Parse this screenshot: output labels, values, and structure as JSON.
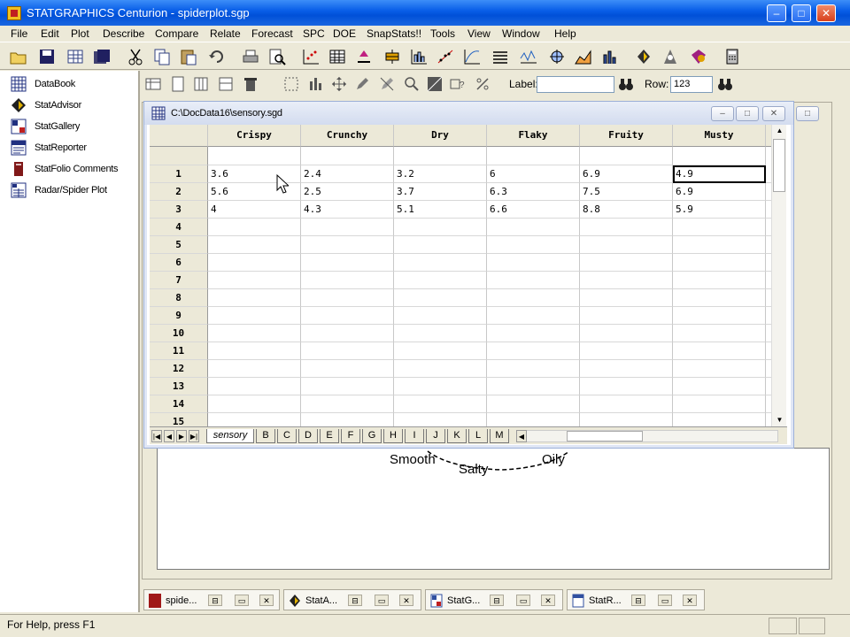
{
  "app": {
    "title": "STATGRAPHICS Centurion - spiderplot.sgp"
  },
  "window_controls": {
    "minimize": "–",
    "maximize": "□",
    "close": "✕"
  },
  "menu": [
    "File",
    "Edit",
    "Plot",
    "Describe",
    "Compare",
    "Relate",
    "Forecast",
    "SPC",
    "DOE",
    "SnapStats!!",
    "Tools",
    "View",
    "Window",
    "Help"
  ],
  "toolbar2": {
    "label_text": "Label:",
    "label_value": "",
    "row_text": "Row:",
    "row_value": "123"
  },
  "left_pane": {
    "items": [
      {
        "label": "DataBook",
        "icon": "databook-icon"
      },
      {
        "label": "StatAdvisor",
        "icon": "statadvisor-icon"
      },
      {
        "label": "StatGallery",
        "icon": "statgallery-icon"
      },
      {
        "label": "StatReporter",
        "icon": "statreporter-icon"
      },
      {
        "label": "StatFolio Comments",
        "icon": "statfolio-icon"
      },
      {
        "label": "Radar/Spider Plot",
        "icon": "spider-plot-icon"
      }
    ]
  },
  "data_window": {
    "title": "C:\\DocData16\\sensory.sgd",
    "columns": [
      "Crispy",
      "Crunchy",
      "Dry",
      "Flaky",
      "Fruity",
      "Musty"
    ],
    "rows": [
      [
        "3.6",
        "2.4",
        "3.2",
        "6",
        "6.9",
        "4.9"
      ],
      [
        "5.6",
        "2.5",
        "3.7",
        "6.3",
        "7.5",
        "6.9"
      ],
      [
        "4",
        "4.3",
        "5.1",
        "6.6",
        "8.8",
        "5.9"
      ]
    ],
    "row_numbers": [
      "1",
      "2",
      "3",
      "4",
      "5",
      "6",
      "7",
      "8",
      "9",
      "10",
      "11",
      "12",
      "13",
      "14",
      "15"
    ],
    "sheet_tabs": [
      "sensory",
      "B",
      "C",
      "D",
      "E",
      "F",
      "G",
      "H",
      "I",
      "J",
      "K",
      "L",
      "M"
    ]
  },
  "plot_labels": [
    "Smooth",
    "Salty",
    "Oily"
  ],
  "mdi_windows": [
    {
      "label": "spide...",
      "color": "#a01818"
    },
    {
      "label": "StatA...",
      "color": "#202020"
    },
    {
      "label": "StatG...",
      "color": "#3050a0"
    },
    {
      "label": "StatR...",
      "color": "#3050a0"
    }
  ],
  "status": {
    "help_text": "For Help, press F1"
  }
}
